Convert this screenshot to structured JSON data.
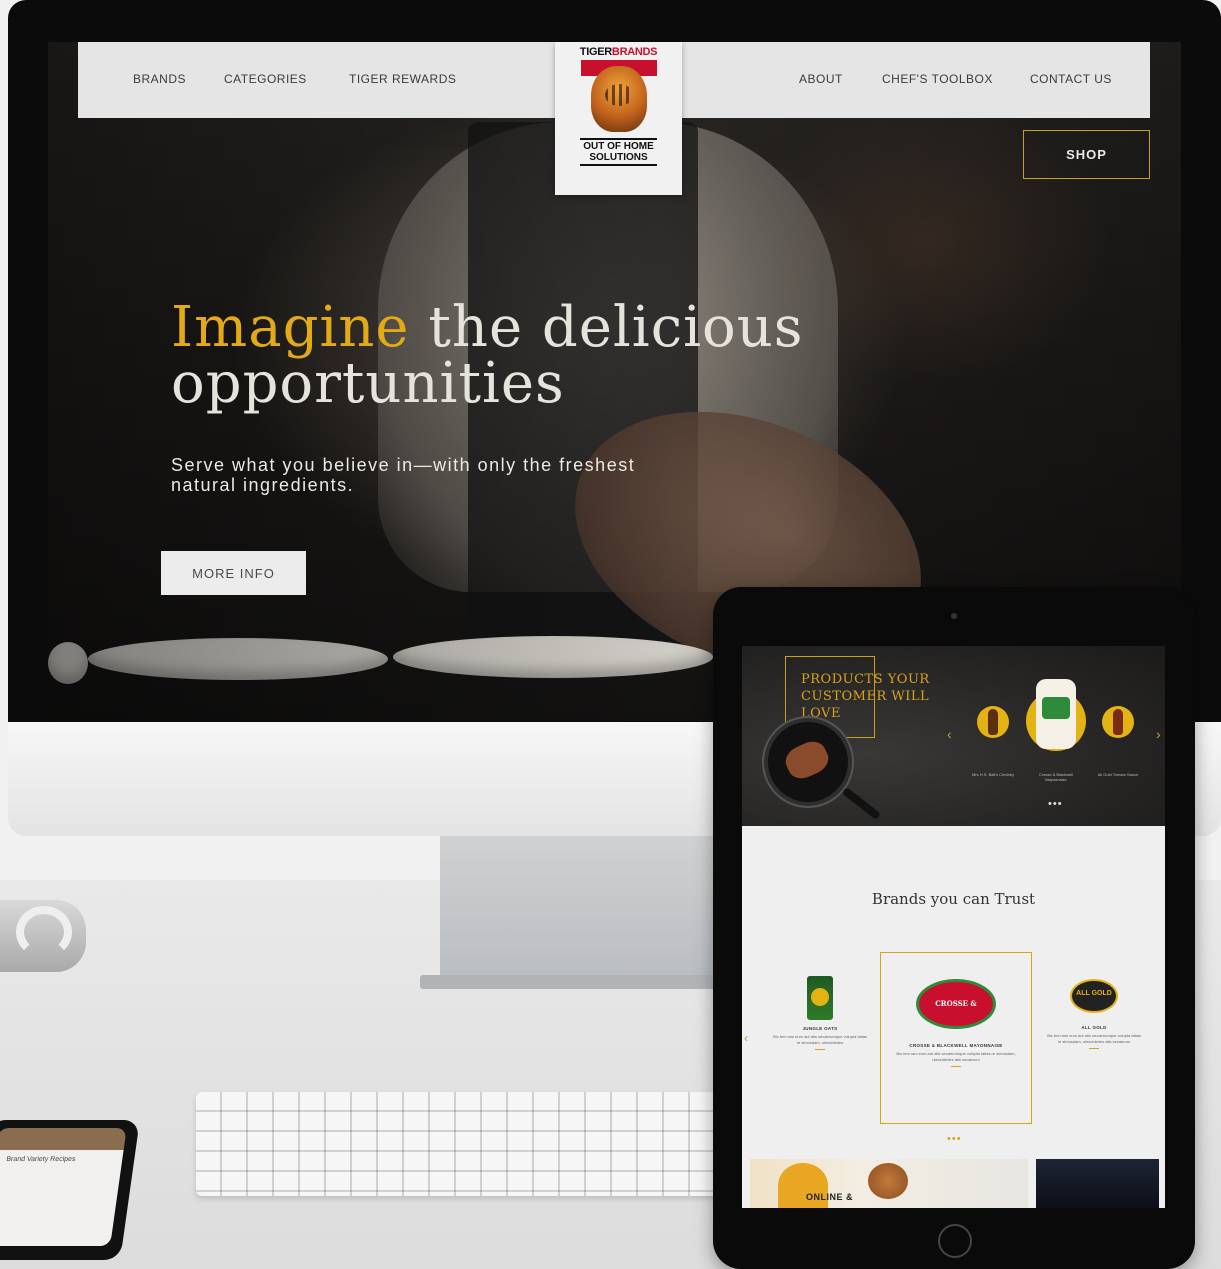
{
  "desktop": {
    "nav_left": [
      "BRANDS",
      "CATEGORIES",
      "TIGER REWARDS"
    ],
    "nav_right": [
      "ABOUT",
      "CHEF'S TOOLBOX",
      "CONTACT US"
    ],
    "logo": {
      "brand_top_black": "TIGER",
      "brand_top_red": "BRANDS",
      "subtitle_line1": "OUT OF HOME",
      "subtitle_line2": "SOLUTIONS"
    },
    "shop_label": "SHOP",
    "headline_gold": "Imagine",
    "headline_rest_line1": " the delicious",
    "headline_line2": "opportunities",
    "subheadline": "Serve what you believe in—with only the freshest natural ingredients.",
    "cta_label": "MORE INFO"
  },
  "tablet": {
    "promo_title": "PRODUCTS YOUR CUSTOMER WILL LOVE",
    "products": [
      "Mrs H.S. Ball's Chutney",
      "Crosse & Blackwell Mayonnaise",
      "All Gold Tomato Sauce"
    ],
    "section_title": "Brands you can Trust",
    "brands": [
      {
        "name": "JUNGLE OATS",
        "desc": "Illic tem lam eum aut atis secaerumque volupta tatias re simusdam, utescidedes"
      },
      {
        "name": "CROSSE & BLACKWELL MAYONNAISE",
        "desc": "Illic tem lam eum aut atis secaerumque volupta tatias re simusdam, utescidedes atis secaerum"
      },
      {
        "name": "ALL GOLD",
        "desc": "Illic tem lam eum aut atis secaerumque volupta tatias re simusdam, utescidedes atis secaerum"
      }
    ],
    "brand_logo_text": {
      "cb": "CROSSE & BLACKWELL",
      "ag": "ALL GOLD"
    },
    "tile_text": "ONLINE &"
  },
  "phone": {
    "title": "Brand Variety Recipes"
  },
  "colors": {
    "accent_gold": "#e2aa17",
    "nav_bg": "#e5e5e5",
    "brand_red": "#c8102e"
  },
  "icons": {
    "prev": "chevron-left-icon",
    "next": "chevron-right-icon"
  }
}
